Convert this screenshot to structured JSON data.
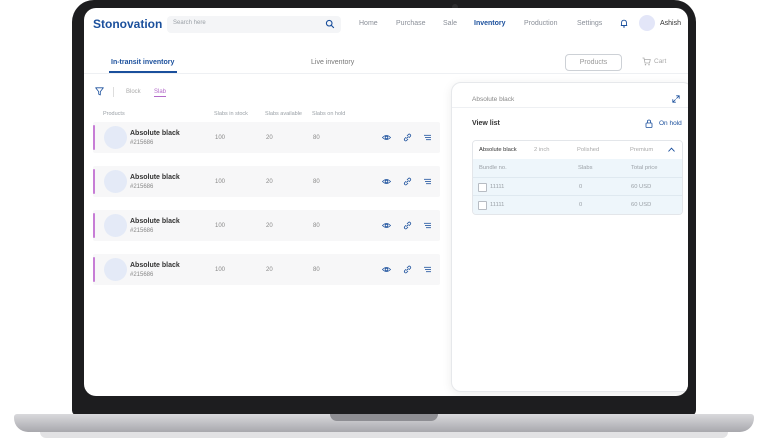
{
  "app": {
    "brand": "Stonovation"
  },
  "search": {
    "placeholder": "Search here"
  },
  "nav": {
    "items": [
      "Home",
      "Purchase",
      "Sale",
      "Inventory",
      "Production",
      "Settings"
    ],
    "active": "Inventory"
  },
  "user": {
    "name": "Ashish"
  },
  "tabs": {
    "items": [
      "In-transit inventory",
      "Live inventory"
    ],
    "active": "In-transit inventory"
  },
  "toolbar": {
    "products_label": "Products",
    "cart_label": "Cart"
  },
  "filter": {
    "segments": [
      "Block",
      "Slab"
    ],
    "active": "Slab"
  },
  "table": {
    "columns": [
      "Products",
      "Slabs in stock",
      "Slabs available",
      "Slabs on hold"
    ],
    "rows": [
      {
        "name": "Absolute black",
        "code": "#215686",
        "in_stock": "100",
        "available": "20",
        "on_hold": "80"
      },
      {
        "name": "Absolute black",
        "code": "#215686",
        "in_stock": "100",
        "available": "20",
        "on_hold": "80"
      },
      {
        "name": "Absolute black",
        "code": "#215686",
        "in_stock": "100",
        "available": "20",
        "on_hold": "80"
      },
      {
        "name": "Absolute black",
        "code": "#215686",
        "in_stock": "100",
        "available": "20",
        "on_hold": "80"
      }
    ],
    "row_icons": [
      "eye-icon",
      "link-icon",
      "list-icon"
    ]
  },
  "detail": {
    "title": "Absolute black",
    "view_list_label": "View list",
    "on_hold_label": "On hold",
    "summary": [
      "Absolute black",
      "2 inch",
      "Polished",
      "Premium"
    ],
    "columns": [
      "Bundle no.",
      "Slabs",
      "Total price"
    ],
    "rows": [
      {
        "bundle": "11111",
        "slabs": "0",
        "price": "60 USD"
      },
      {
        "bundle": "11111",
        "slabs": "0",
        "price": "60 USD"
      }
    ]
  },
  "colors": {
    "brand": "#1a4f9c",
    "accent": "#b36ac9",
    "row_accent": "#c77dd6"
  }
}
